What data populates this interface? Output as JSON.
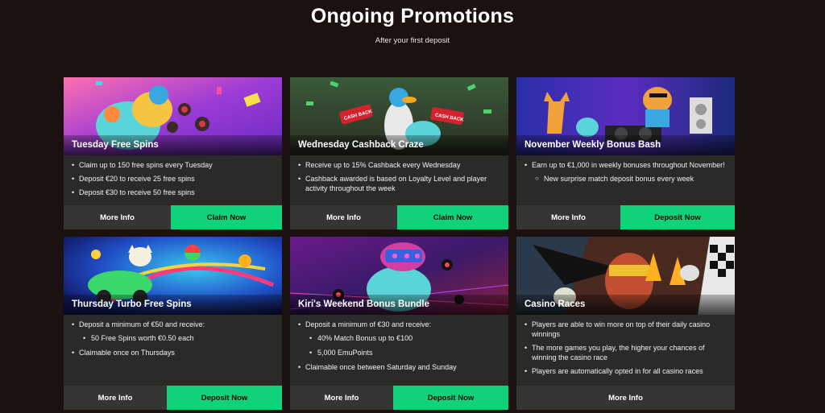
{
  "header": {
    "title": "Ongoing Promotions",
    "subtitle": "After your first deposit"
  },
  "colors": {
    "accent": "#10d27a",
    "card": "#2a2a28",
    "background": "#1a1110"
  },
  "cards": [
    {
      "title": "Tuesday Free Spins",
      "bullets": [
        "Claim up to 150 free spins every Tuesday",
        "Deposit €20 to receive 25 free spins",
        "Deposit €30 to receive 50 free spins"
      ],
      "info_label": "More Info",
      "action_label": "Claim Now"
    },
    {
      "title": "Wednesday Cashback Craze",
      "bullets": [
        "Receive up to 15% Cashback every Wednesday",
        "Cashback awarded is based on Loyalty Level and player activity throughout the week"
      ],
      "info_label": "More Info",
      "action_label": "Claim Now",
      "banner_text": {
        "cash_back_left": "CASH BACK",
        "cash_back_right": "CASH BACK"
      }
    },
    {
      "title": "November Weekly Bonus Bash",
      "bullets": [
        "Earn up to €1,000 in weekly bonuses throughout November!"
      ],
      "sub_bullets": [
        "New surprise match deposit bonus every week"
      ],
      "info_label": "More Info",
      "action_label": "Deposit Now"
    },
    {
      "title": "Thursday Turbo Free Spins",
      "bullets": [
        "Deposit a minimum of €50 and receive:",
        "Claimable once on Thursdays"
      ],
      "sub_bullets": [
        "50 Free Spins worth €0.50 each"
      ],
      "info_label": "More Info",
      "action_label": "Deposit Now"
    },
    {
      "title": "Kiri's Weekend Bonus Bundle",
      "bullets": [
        "Deposit a minimum of €30 and receive:",
        "Claimable once between Saturday and Sunday"
      ],
      "sub_bullets": [
        "40% Match Bonus up to €100",
        "5,000 EmuPoints"
      ],
      "info_label": "More Info",
      "action_label": "Deposit Now"
    },
    {
      "title": "Casino Races",
      "bullets": [
        "Players are able to win more on top of their daily casino winnings",
        "The more games you play, the higher your chances of winning the casino race",
        "Players are automatically opted in for all casino races"
      ],
      "info_label": "More Info"
    }
  ]
}
